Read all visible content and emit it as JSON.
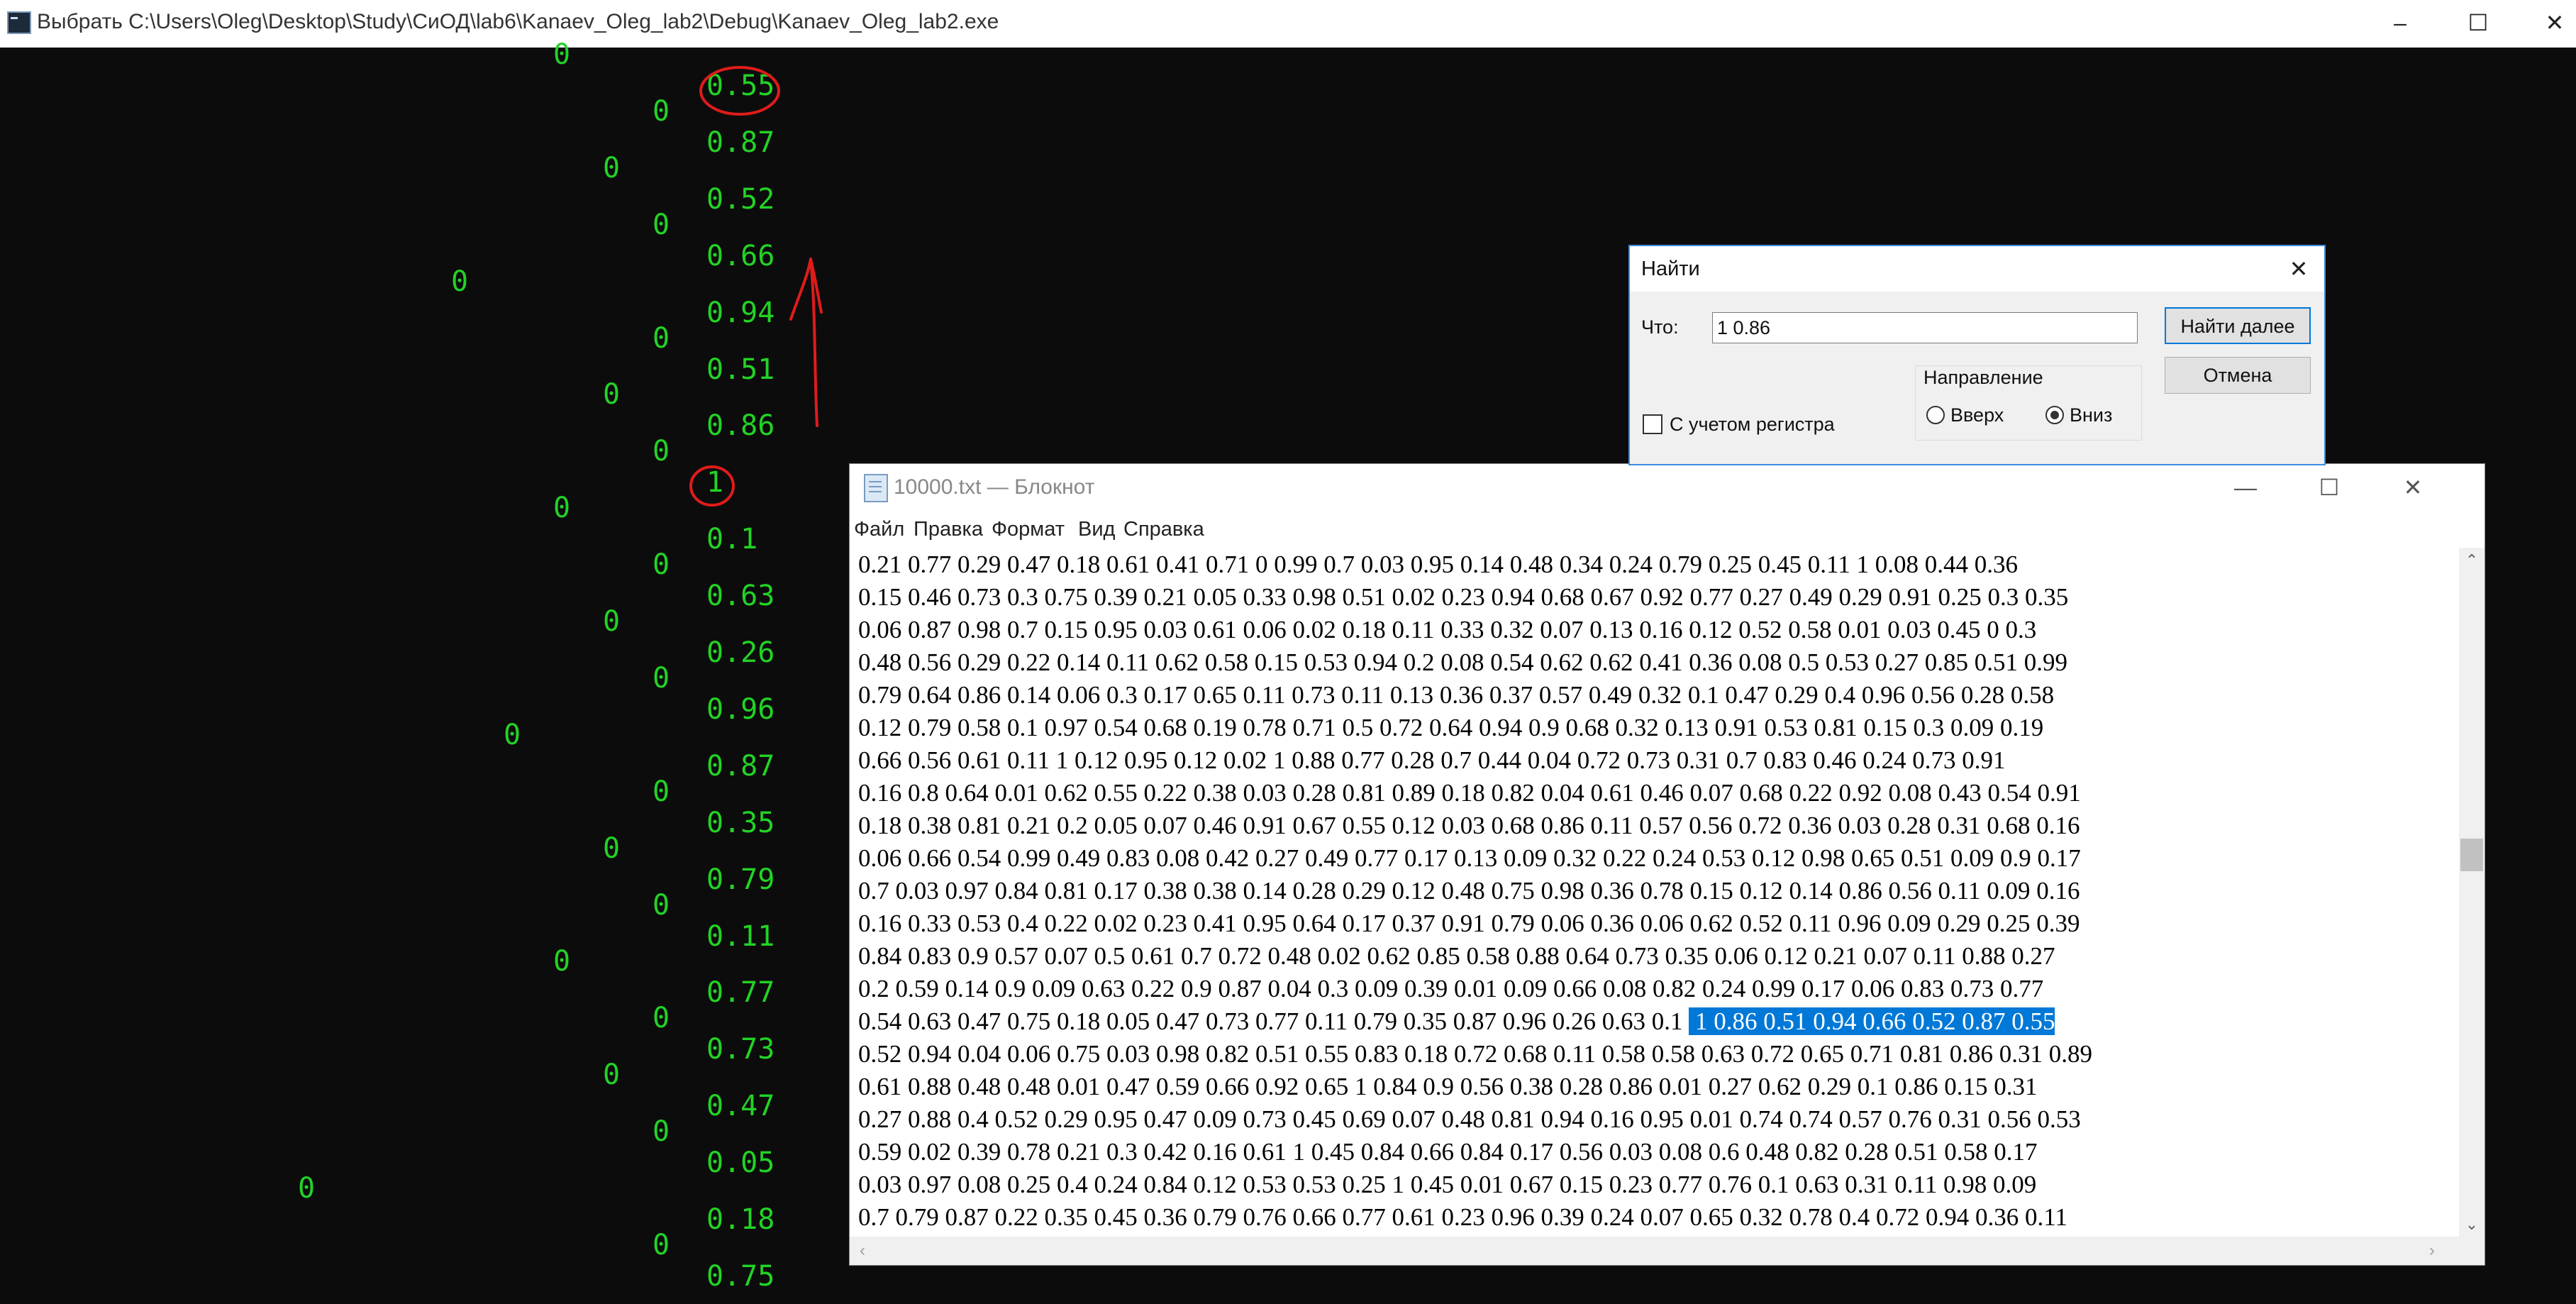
{
  "console": {
    "title": "Выбрать C:\\Users\\Oleg\\Desktop\\Study\\СиОД\\lab6\\Kanaev_Oleg_lab2\\Debug\\Kanaev_Oleg_lab2.exe",
    "caption_buttons": [
      "–",
      "☐",
      "✕"
    ],
    "text_color": "#22d325",
    "zeros": [
      "0",
      "0",
      "0",
      "0",
      "0",
      "0",
      "0",
      "0",
      "0",
      "0",
      "0",
      "0",
      "0",
      "0",
      "0",
      "0",
      "0",
      "0",
      "0",
      "0",
      "0",
      "0"
    ],
    "values": [
      "0.55",
      "0.87",
      "0.52",
      "0.66",
      "0.94",
      "0.51",
      "0.86",
      "1",
      "0.1",
      "0.63",
      "0.26",
      "0.96",
      "0.87",
      "0.35",
      "0.79",
      "0.11",
      "0.77",
      "0.73",
      "0.47",
      "0.05",
      "0.18",
      "0.75"
    ]
  },
  "notepad": {
    "title": "10000.txt — Блокнот",
    "caption_buttons": [
      "—",
      "☐",
      "✕"
    ],
    "menu": [
      "Файл",
      "Правка",
      "Формат",
      "Вид",
      "Справка"
    ],
    "lines": [
      "0.21 0.77 0.29 0.47 0.18 0.61 0.41 0.71 0 0.99 0.7 0.03 0.95 0.14 0.48 0.34 0.24 0.79 0.25 0.45 0.11 1 0.08 0.44 0.36",
      "0.15 0.46 0.73 0.3 0.75 0.39 0.21 0.05 0.33 0.98 0.51 0.02 0.23 0.94 0.68 0.67 0.92 0.77 0.27 0.49 0.29 0.91 0.25 0.3 0.35",
      "0.06 0.87 0.98 0.7 0.15 0.95 0.03 0.61 0.06 0.02 0.18 0.11 0.33 0.32 0.07 0.13 0.16 0.12 0.52 0.58 0.01 0.03 0.45 0 0.3",
      "0.48 0.56 0.29 0.22 0.14 0.11 0.62 0.58 0.15 0.53 0.94 0.2 0.08 0.54 0.62 0.62 0.41 0.36 0.08 0.5 0.53 0.27 0.85 0.51 0.99",
      "0.79 0.64 0.86 0.14 0.06 0.3 0.17 0.65 0.11 0.73 0.11 0.13 0.36 0.37 0.57 0.49 0.32 0.1 0.47 0.29 0.4 0.96 0.56 0.28 0.58",
      "0.12 0.79 0.58 0.1 0.97 0.54 0.68 0.19 0.78 0.71 0.5 0.72 0.64 0.94 0.9 0.68 0.32 0.13 0.91 0.53 0.81 0.15 0.3 0.09 0.19",
      "0.66 0.56 0.61 0.11 1 0.12 0.95 0.12 0.02 1 0.88 0.77 0.28 0.7 0.44 0.04 0.72 0.73 0.31 0.7 0.83 0.46 0.24 0.73 0.91",
      "0.16 0.8 0.64 0.01 0.62 0.55 0.22 0.38 0.03 0.28 0.81 0.89 0.18 0.82 0.04 0.61 0.46 0.07 0.68 0.22 0.92 0.08 0.43 0.54 0.91",
      "0.18 0.38 0.81 0.21 0.2 0.05 0.07 0.46 0.91 0.67 0.55 0.12 0.03 0.68 0.86 0.11 0.57 0.56 0.72 0.36 0.03 0.28 0.31 0.68 0.16",
      "0.06 0.66 0.54 0.99 0.49 0.83 0.08 0.42 0.27 0.49 0.77 0.17 0.13 0.09 0.32 0.22 0.24 0.53 0.12 0.98 0.65 0.51 0.09 0.9 0.17",
      "0.7 0.03 0.97 0.84 0.81 0.17 0.38 0.38 0.14 0.28 0.29 0.12 0.48 0.75 0.98 0.36 0.78 0.15 0.12 0.14 0.86 0.56 0.11 0.09 0.16",
      "0.16 0.33 0.53 0.4 0.22 0.02 0.23 0.41 0.95 0.64 0.17 0.37 0.91 0.79 0.06 0.36 0.06 0.62 0.52 0.11 0.96 0.09 0.29 0.25 0.39",
      "0.84 0.83 0.9 0.57 0.07 0.5 0.61 0.7 0.72 0.48 0.02 0.62 0.85 0.58 0.88 0.64 0.73 0.35 0.06 0.12 0.21 0.07 0.11 0.88 0.27",
      "0.2 0.59 0.14 0.9 0.09 0.63 0.22 0.9 0.87 0.04 0.3 0.09 0.39 0.01 0.09 0.66 0.08 0.82 0.24 0.99 0.17 0.06 0.83 0.73 0.77",
      "0.54 0.63 0.47 0.75 0.18 0.05 0.47 0.73 0.77 0.11 0.79 0.35 0.87 0.96 0.26 0.63 0.1 ",
      "0.52 0.94 0.04 0.06 0.75 0.03 0.98 0.82 0.51 0.55 0.83 0.18 0.72 0.68 0.11 0.58 0.58 0.63 0.72 0.65 0.71 0.81 0.86 0.31 0.89",
      "0.61 0.88 0.48 0.48 0.01 0.47 0.59 0.66 0.92 0.65 1 0.84 0.9 0.56 0.38 0.28 0.86 0.01 0.27 0.62 0.29 0.1 0.86 0.15 0.31",
      "0.27 0.88 0.4 0.52 0.29 0.95 0.47 0.09 0.73 0.45 0.69 0.07 0.48 0.81 0.94 0.16 0.95 0.01 0.74 0.74 0.57 0.76 0.31 0.56 0.53",
      "0.59 0.02 0.39 0.78 0.21 0.3 0.42 0.16 0.61 1 0.45 0.84 0.66 0.84 0.17 0.56 0.03 0.08 0.6 0.48 0.82 0.28 0.51 0.58 0.17",
      "0.03 0.97 0.08 0.25 0.4 0.24 0.84 0.12 0.53 0.53 0.25 1 0.45 0.01 0.67 0.15 0.23 0.77 0.76 0.1 0.63 0.31 0.11 0.98 0.09",
      "0.7 0.79 0.87 0.22 0.35 0.45 0.36 0.79 0.76 0.66 0.77 0.61 0.23 0.96 0.39 0.24 0.07 0.65 0.32 0.78 0.4 0.72 0.94 0.36 0.11"
    ],
    "selection_line": 14,
    "selected_text": " 1 0.86 0.51 0.94 0.66 0.52 0.87 0.55",
    "selection_color": "#0078d7"
  },
  "find_dialog": {
    "title": "Найти",
    "close": "✕",
    "what_label": "Что:",
    "what_value": "1 0.86",
    "find_next_label": "Найти далее",
    "cancel_label": "Отмена",
    "direction_label": "Направление",
    "up_label": "Вверх",
    "down_label": "Вниз",
    "direction": "down",
    "match_case_label": "С учетом регистра",
    "match_case": false
  }
}
